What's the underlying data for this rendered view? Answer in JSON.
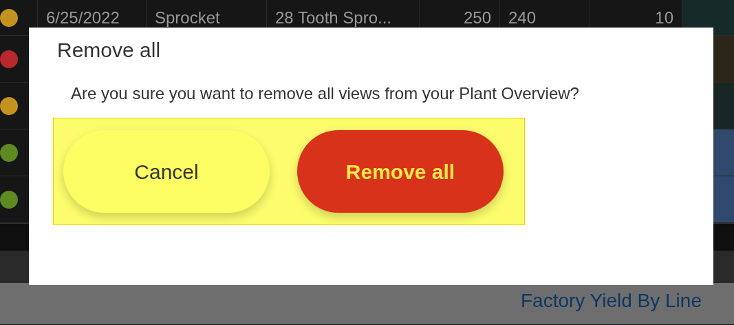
{
  "table": {
    "rows": [
      {
        "color": "#c4921e",
        "heat": {
          "color": "#172a2a"
        },
        "cells": [
          "6/25/2022",
          "Sprocket",
          "28 Tooth Spro...",
          "250",
          "240",
          "10"
        ]
      },
      {
        "color": "#b8282c",
        "heat": {
          "color": "#2c2619"
        },
        "cells": []
      },
      {
        "color": "#c4921e",
        "heat": {
          "color": "#182626"
        },
        "cells": []
      },
      {
        "color": "#5e8a22",
        "heat": {
          "color": "#2f486b"
        },
        "cells": []
      },
      {
        "color": "#5e8a22",
        "heat": {
          "color": "#2f486b"
        },
        "cells": []
      }
    ]
  },
  "footer": {
    "title": "Factory Yield By Line"
  },
  "dialog": {
    "title": "Remove all",
    "message": "Are you sure you want to remove all views from your Plant Overview?",
    "buttons": [
      {
        "label": "Cancel",
        "kind": "secondary"
      },
      {
        "label": "Remove all",
        "kind": "primary"
      }
    ]
  }
}
